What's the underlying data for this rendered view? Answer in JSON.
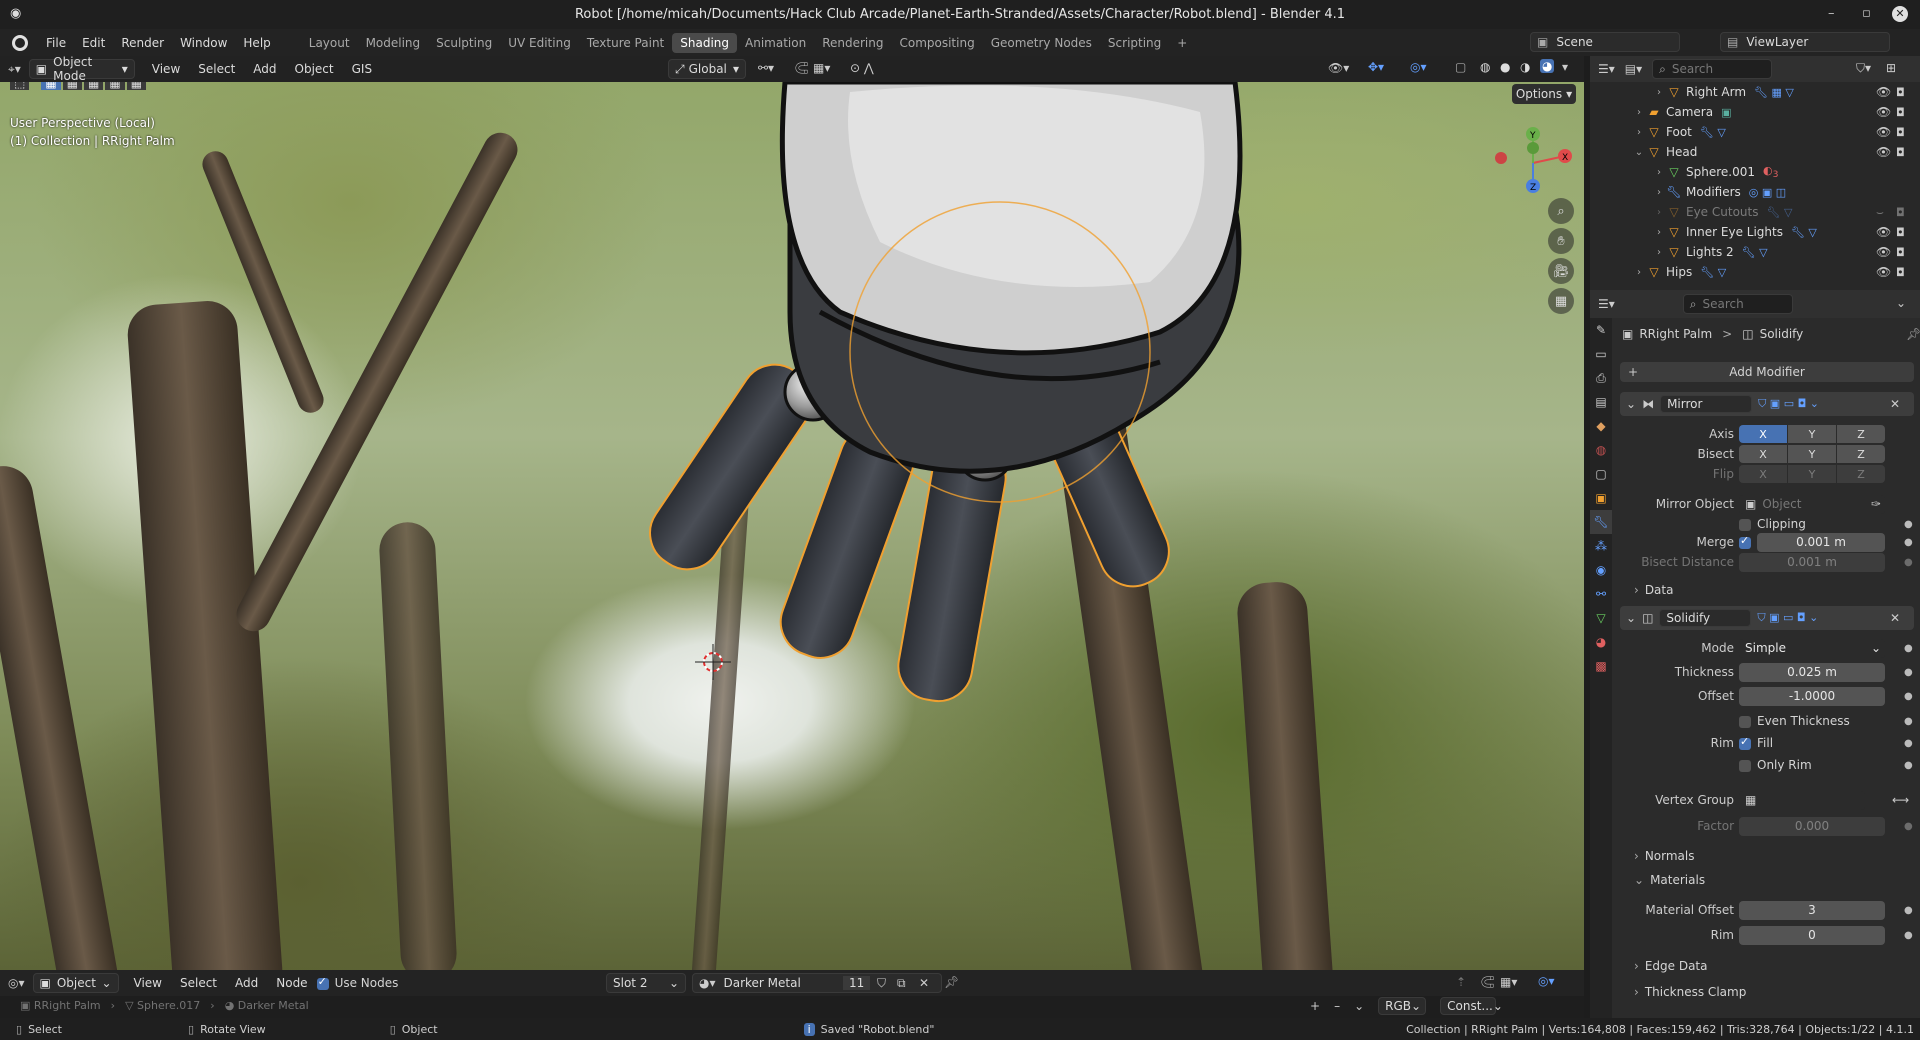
{
  "window": {
    "title": "Robot [/home/micah/Documents/Hack Club Arcade/Planet-Earth-Stranded/Assets/Character/Robot.blend] - Blender 4.1"
  },
  "menu": {
    "items": [
      "File",
      "Edit",
      "Render",
      "Window",
      "Help"
    ],
    "workspaces": [
      "Layout",
      "Modeling",
      "Sculpting",
      "UV Editing",
      "Texture Paint",
      "Shading",
      "Animation",
      "Rendering",
      "Compositing",
      "Geometry Nodes",
      "Scripting"
    ],
    "active_workspace": "Shading",
    "plus": "+",
    "scene": "Scene",
    "view_layer": "ViewLayer"
  },
  "viewport_header": {
    "mode": "Object Mode",
    "menus": [
      "View",
      "Select",
      "Add",
      "Object",
      "GIS"
    ],
    "orientation": "Global"
  },
  "viewport": {
    "info_line1": "User Perspective (Local)",
    "info_line2": "(1) Collection | RRight Palm",
    "options": "Options",
    "gizmo": {
      "x": "X",
      "y": "Y",
      "z": "Z"
    }
  },
  "outliner": {
    "search_placeholder": "Search",
    "rows": [
      {
        "label": "Right Arm",
        "expanded": false,
        "dim": false
      },
      {
        "label": "Camera",
        "expanded": false,
        "dim": false
      },
      {
        "label": "Foot",
        "expanded": false,
        "dim": false
      },
      {
        "label": "Head",
        "expanded": true,
        "dim": false
      },
      {
        "label": "Sphere.001",
        "expanded": false,
        "dim": false,
        "badge": "3"
      },
      {
        "label": "Modifiers",
        "expanded": false,
        "dim": false
      },
      {
        "label": "Eye Cutouts",
        "expanded": false,
        "dim": true
      },
      {
        "label": "Inner Eye Lights",
        "expanded": false,
        "dim": false
      },
      {
        "label": "Lights 2",
        "expanded": false,
        "dim": false
      },
      {
        "label": "Hips",
        "expanded": false,
        "dim": false
      }
    ]
  },
  "properties": {
    "search_placeholder": "Search",
    "object": "RRight Palm",
    "breadcrumb_sep": ">",
    "modifier_context": "Solidify",
    "add_modifier": "Add Modifier",
    "mirror": {
      "name": "Mirror",
      "axis_label": "Axis",
      "bisect_label": "Bisect",
      "flip_label": "Flip",
      "axes": [
        "X",
        "Y",
        "Z"
      ],
      "mirror_object_label": "Mirror Object",
      "mirror_object_placeholder": "Object",
      "clipping": "Clipping",
      "merge_label": "Merge",
      "merge_value": "0.001 m",
      "bisect_distance_label": "Bisect Distance",
      "bisect_distance_value": "0.001 m",
      "data": "Data"
    },
    "solidify": {
      "name": "Solidify",
      "mode_label": "Mode",
      "mode_value": "Simple",
      "thickness_label": "Thickness",
      "thickness_value": "0.025 m",
      "offset_label": "Offset",
      "offset_value": "-1.0000",
      "even_thickness": "Even Thickness",
      "rim_label": "Rim",
      "fill": "Fill",
      "only_rim": "Only Rim",
      "vertex_group_label": "Vertex Group",
      "factor_label": "Factor",
      "factor_value": "0.000",
      "normals": "Normals",
      "materials": "Materials",
      "material_offset_label": "Material Offset",
      "material_offset_value": "3",
      "rim_mat_label": "Rim",
      "rim_mat_value": "0",
      "edge_data": "Edge Data",
      "thickness_clamp": "Thickness Clamp"
    }
  },
  "node_header": {
    "type": "Object",
    "menus": [
      "View",
      "Select",
      "Add",
      "Node"
    ],
    "use_nodes": "Use Nodes",
    "slot": "Slot 2",
    "material": "Darker Metal",
    "users": "11",
    "color": "RGB",
    "const": "Const..."
  },
  "node_breadcrumb": {
    "object": "RRight Palm",
    "mesh": "Sphere.017",
    "material": "Darker Metal"
  },
  "status": {
    "select": "Select",
    "rotate": "Rotate View",
    "object": "Object",
    "saved": "Saved \"Robot.blend\"",
    "stats": "Collection | RRight Palm | Verts:164,808 | Faces:159,462 | Tris:328,764 | Objects:1/22 | 4.1.1"
  },
  "colors": {
    "accent": "#4772b3",
    "selection": "#f0a030",
    "active_tab": "#4a4a4a"
  }
}
